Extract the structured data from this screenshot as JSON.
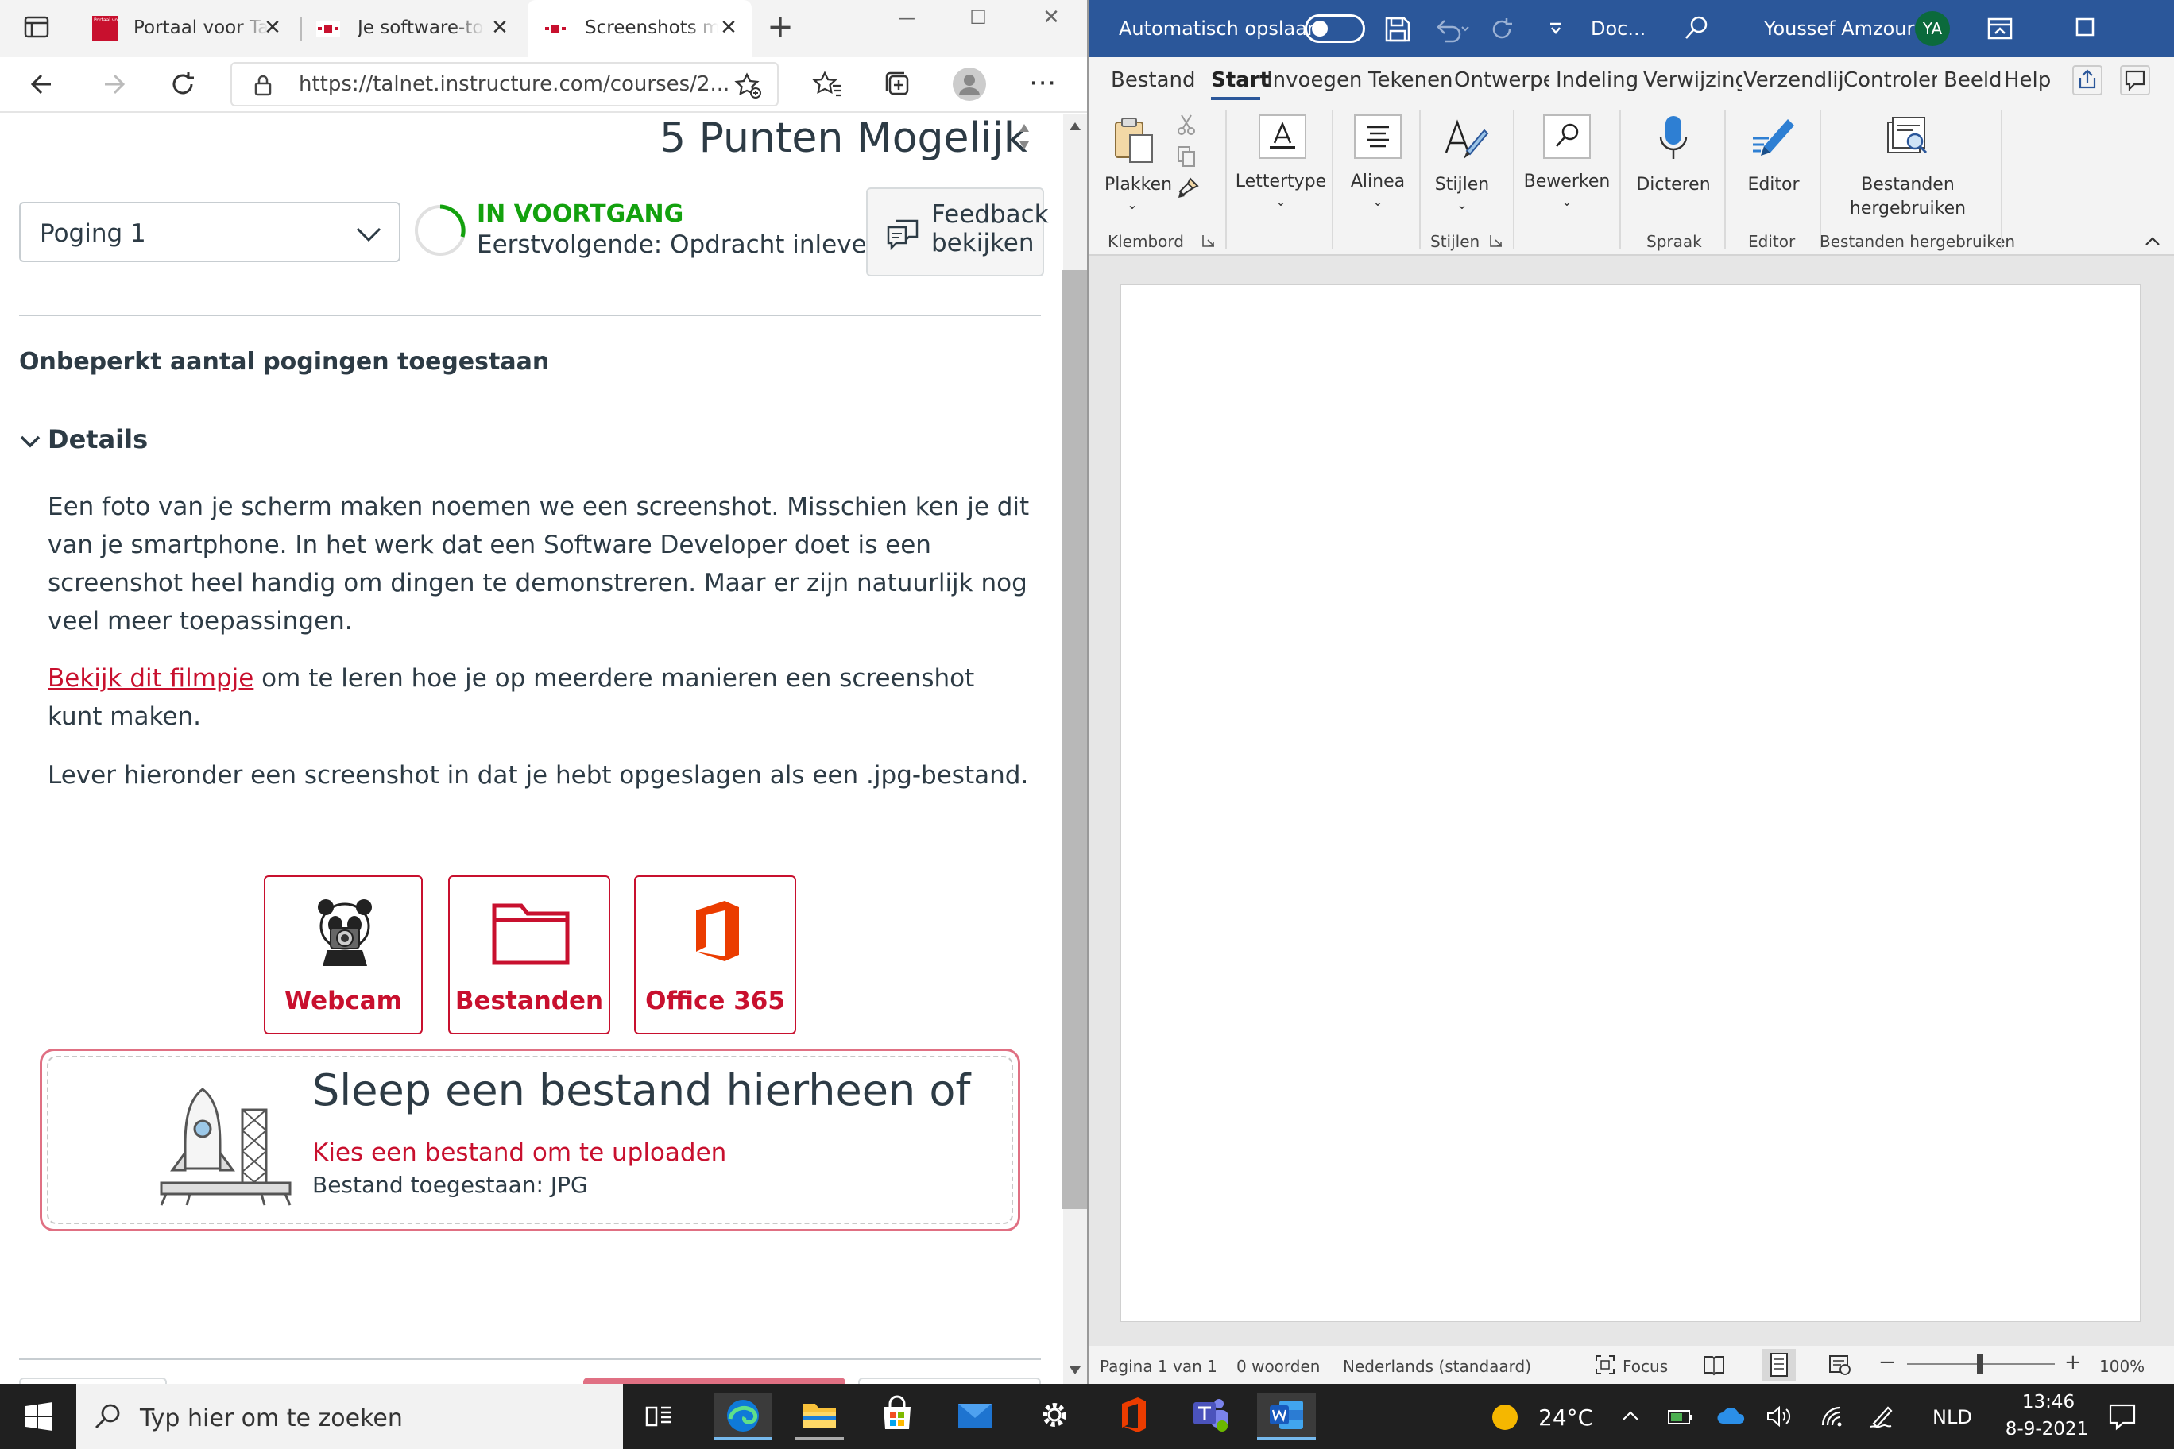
{
  "browser": {
    "tabs": [
      {
        "title": "Portaal voor Talent",
        "favicon_text": "Portaal voor Talent",
        "close": "✕"
      },
      {
        "title": "Je software-tools",
        "close": "✕"
      },
      {
        "title": "Screenshots maken",
        "close": "✕"
      }
    ],
    "new_tab": "+",
    "window_controls": {
      "minimize": "—",
      "maximize": "☐",
      "close": "✕"
    },
    "url": "https://talnet.instructure.com/courses/2..."
  },
  "assignment": {
    "points_heading": "5 Punten Mogelijk",
    "attempt_select": "Poging 1",
    "status": "IN VOORTGANG",
    "next_step": "Eerstvolgende: Opdracht inleveren",
    "feedback_line1": "Feedback",
    "feedback_line2": "bekijken",
    "attempts_note": "Onbeperkt aantal pogingen toegestaan",
    "details_label": "Details",
    "paragraph1": "Een foto van je scherm maken noemen we een screenshot. Misschien ken je dit van je smartphone. In het werk dat een Software Developer doet is een screenshot heel handig om dingen te demonstreren. Maar er zijn natuurlijk nog veel meer toepassingen.",
    "link_text": "Bekijk dit filmpje",
    "paragraph2_rest": " om te leren hoe je op meerdere manieren een screenshot kunt maken.",
    "paragraph3": "Lever hieronder een screenshot in dat je hebt opgeslagen als een .jpg-bestand.",
    "upload_options": [
      {
        "label": "Webcam",
        "icon": "panda-camera-icon"
      },
      {
        "label": "Bestanden",
        "icon": "folder-icon"
      },
      {
        "label": "Office 365",
        "icon": "office-icon"
      }
    ],
    "dropzone_title": "Sleep een bestand hierheen of",
    "dropzone_link": "Kies een bestand om te uploaden",
    "dropzone_allowed": "Bestand toegestaan: JPG"
  },
  "word": {
    "autosave_label": "Automatisch opslaan",
    "doc_title": "Doc...",
    "user_name": "Youssef Amzour",
    "user_initials": "YA",
    "ribbon_tabs": [
      "Bestand",
      "Start",
      "Invoegen",
      "Tekenen",
      "Ontwerpen",
      "Indeling",
      "Verwijzingen",
      "Verzendlijsten",
      "Controleren",
      "Beeld",
      "Help"
    ],
    "active_tab": "Start",
    "ribbon": {
      "plakken": "Plakken",
      "lettertype": "Lettertype",
      "alinea": "Alinea",
      "stijlen": "Stijlen",
      "bewerken": "Bewerken",
      "dicteren": "Dicteren",
      "editor": "Editor",
      "bestanden_line1": "Bestanden",
      "bestanden_line2": "hergebruiken"
    },
    "ribbon_groups": {
      "klembord": "Klembord",
      "stijlen": "Stijlen",
      "spraak": "Spraak",
      "editor": "Editor",
      "bestanden": "Bestanden hergebruiken"
    },
    "status": {
      "page": "Pagina 1 van 1",
      "words": "0 woorden",
      "language": "Nederlands (standaard)",
      "focus": "Focus",
      "zoom": "100%"
    }
  },
  "taskbar": {
    "search_placeholder": "Typ hier om te zoeken",
    "weather": "24°C",
    "language": "NLD",
    "time": "13:46",
    "date": "8-9-2021"
  },
  "colors": {
    "canvas_red": "#c8102e",
    "status_green": "#13a10e",
    "word_blue": "#2b579a",
    "taskbar": "#202020"
  }
}
